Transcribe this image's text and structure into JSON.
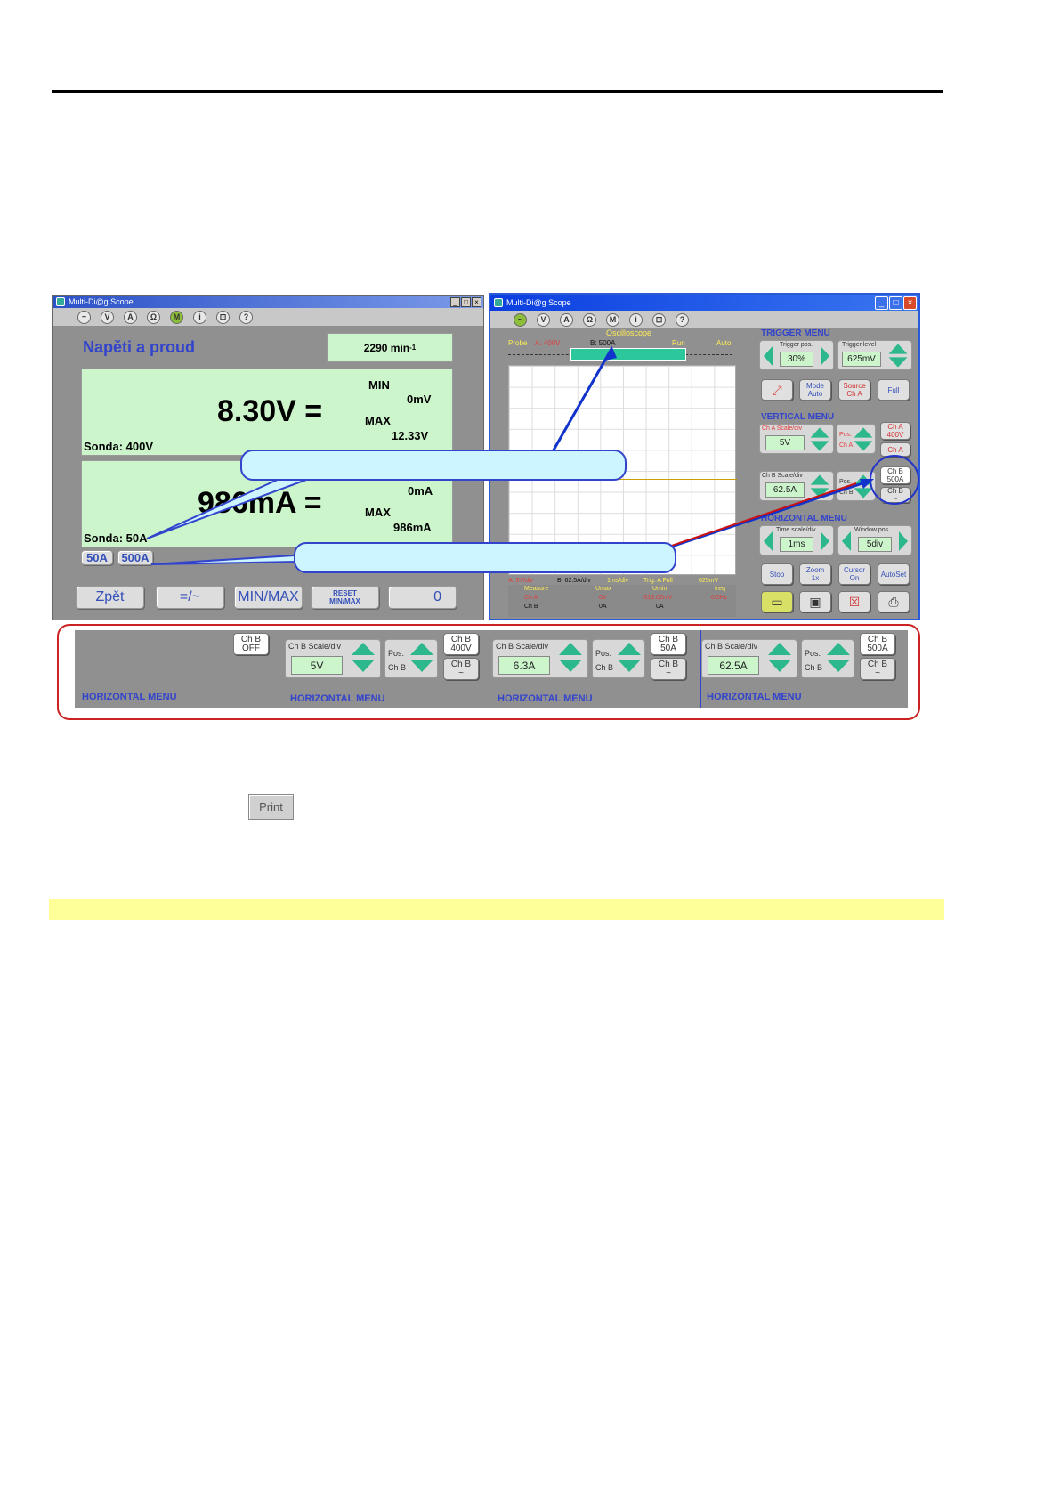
{
  "print_button": "Print",
  "left_window": {
    "title": "Multi-Di@g Scope",
    "toolbar_icons": [
      "~",
      "V",
      "A",
      "Ω",
      "M",
      "i",
      "⊡",
      "?"
    ],
    "heading": "Napěti a proud",
    "rpm": "2290 min",
    "rpm_sup": "-1",
    "volt": {
      "value": "8.30V =",
      "min_label": "MIN",
      "min": "0mV",
      "max_label": "MAX",
      "max": "12.33V",
      "probe": "Sonda: 400V"
    },
    "amp": {
      "value": "986mA =",
      "min_label": "MIN",
      "min": "0mA",
      "max_label": "MAX",
      "max": "986mA",
      "probe": "Sonda: 50A"
    },
    "probe_buttons": [
      "50A",
      "500A"
    ],
    "bottom_buttons": {
      "back": "Zpět",
      "acdc": "=/~",
      "minmax": "MIN/MAX",
      "reset1": "RESET",
      "reset2": "MIN/MAX",
      "zero": "0"
    }
  },
  "right_window": {
    "title": "Multi-Di@g Scope",
    "toolbar_icons": [
      "~",
      "V",
      "A",
      "Ω",
      "M",
      "i",
      "⊡",
      "?"
    ],
    "osc_title": "Oscilloscope",
    "probe_label": "Probe",
    "probe_a": "A: 400V",
    "probe_b": "B: 500A",
    "run": "Run",
    "auto": "Auto",
    "trigger_menu": "TRIGGER MENU",
    "trigger_pos_label": "Trigger pos.",
    "trigger_pos": "30%",
    "trigger_level_label": "Trigger level",
    "trigger_level": "625mV",
    "mode_btn": [
      "Mode",
      "Auto"
    ],
    "source_btn": [
      "Source",
      "Ch A"
    ],
    "full_btn": "Full",
    "vertical_menu": "VERTICAL MENU",
    "cha_scale_label": "Ch A Scale/div",
    "cha_scale": "5V",
    "pos_label": "Pos.",
    "cha_label": "Ch A",
    "cha_btn1": [
      "Ch A",
      "400V"
    ],
    "cha_btn2": "Ch A",
    "chb_scale_label": "Ch B Scale/div",
    "chb_scale": "62.5A",
    "chb_label": "Ch B",
    "chb_btn1": [
      "Ch B",
      "500A"
    ],
    "chb_btn2": [
      "Ch B",
      "~"
    ],
    "horizontal_menu": "HORIZONTAL MENU",
    "time_label": "Time scale/div",
    "time_val": "1ms",
    "window_label": "Window pos.",
    "window_val": "5div",
    "btns": [
      [
        "Stop"
      ],
      [
        "Zoom",
        "1x"
      ],
      [
        "Cursor",
        "On"
      ],
      [
        "AutoSet"
      ]
    ],
    "status": {
      "a": "A: 5V/div",
      "b": "B: 62.5A/div",
      "t": "1ms/div",
      "trig": "Trig: A  Full",
      "lvl": "625mV"
    },
    "measure": {
      "h": [
        "Measure",
        "Umax",
        "Umin",
        "freq"
      ],
      "a": [
        "Ch A",
        "0V",
        "-319.02mV",
        "0.0Hz"
      ],
      "b": [
        "Ch B",
        "0A",
        "0A",
        ""
      ]
    }
  },
  "strip": {
    "hm": "HORIZONTAL MENU",
    "off_btn": [
      "Ch B",
      "OFF"
    ],
    "scale_label": "Ch B Scale/div",
    "scale_label_4": "Ch B Scale/div",
    "pos": "Pos.",
    "chb": "Ch B",
    "segments": [
      {
        "val": "5V",
        "btn": [
          "Ch B",
          "400V"
        ]
      },
      {
        "val": "6.3A",
        "btn": [
          "Ch B",
          "50A"
        ]
      },
      {
        "val": "62.5A",
        "btn": [
          "Ch B",
          "500A"
        ]
      }
    ],
    "btn2": [
      "Ch B",
      "~"
    ]
  }
}
